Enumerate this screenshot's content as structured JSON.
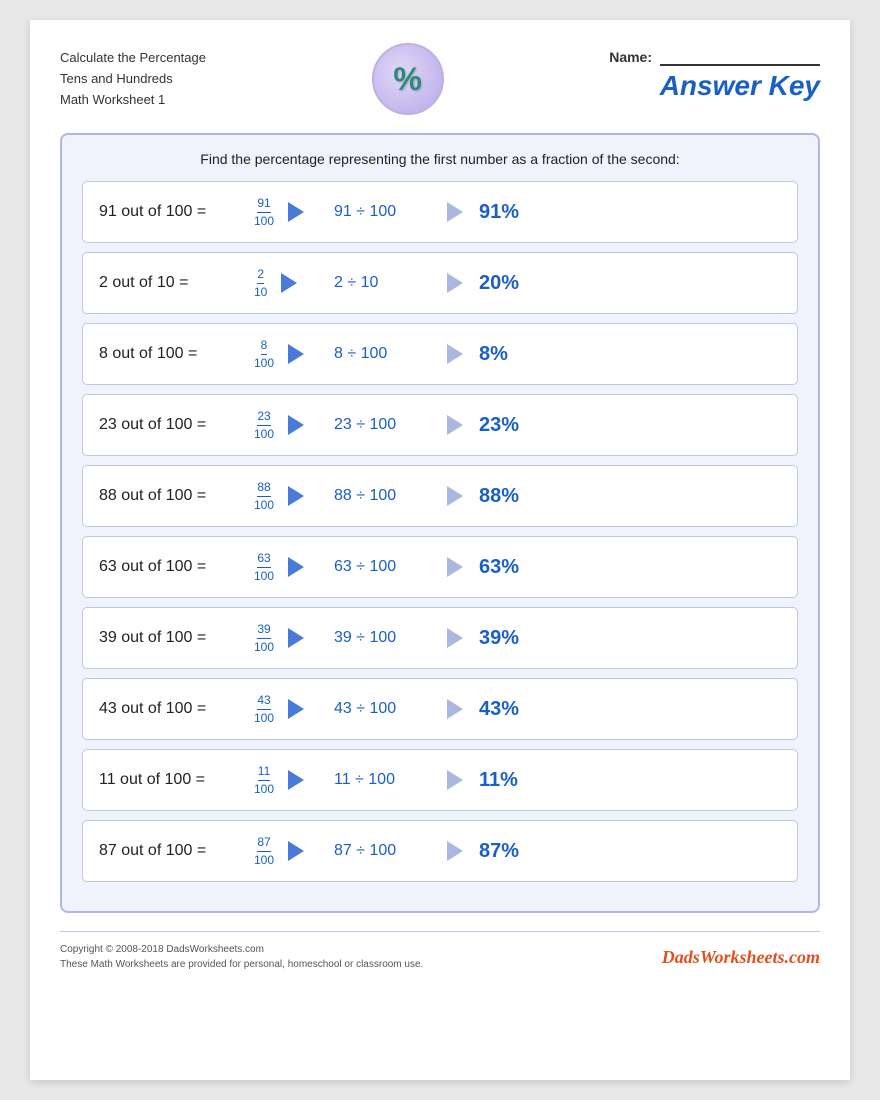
{
  "header": {
    "title_line1": "Calculate the Percentage",
    "title_line2": "Tens and Hundreds",
    "title_line3": "Math Worksheet 1",
    "name_label": "Name:",
    "answer_key": "Answer Key"
  },
  "instruction": "Find the percentage representing the first number as a fraction of the second:",
  "problems": [
    {
      "text": "91 out of 100 =",
      "num": "91",
      "den": "100",
      "division": "91 ÷ 100",
      "result": "91%"
    },
    {
      "text": "2 out of 10 =",
      "num": "2",
      "den": "10",
      "division": "2 ÷ 10",
      "result": "20%"
    },
    {
      "text": "8 out of 100 =",
      "num": "8",
      "den": "100",
      "division": "8 ÷ 100",
      "result": "8%"
    },
    {
      "text": "23 out of 100 =",
      "num": "23",
      "den": "100",
      "division": "23 ÷ 100",
      "result": "23%"
    },
    {
      "text": "88 out of 100 =",
      "num": "88",
      "den": "100",
      "division": "88 ÷ 100",
      "result": "88%"
    },
    {
      "text": "63 out of 100 =",
      "num": "63",
      "den": "100",
      "division": "63 ÷ 100",
      "result": "63%"
    },
    {
      "text": "39 out of 100 =",
      "num": "39",
      "den": "100",
      "division": "39 ÷ 100",
      "result": "39%"
    },
    {
      "text": "43 out of 100 =",
      "num": "43",
      "den": "100",
      "division": "43 ÷ 100",
      "result": "43%"
    },
    {
      "text": "11 out of 100 =",
      "num": "11",
      "den": "100",
      "division": "11 ÷ 100",
      "result": "11%"
    },
    {
      "text": "87 out of 100 =",
      "num": "87",
      "den": "100",
      "division": "87 ÷ 100",
      "result": "87%"
    }
  ],
  "footer": {
    "copyright": "Copyright © 2008-2018 DadsWorksheets.com",
    "note": "These Math Worksheets are provided for personal, homeschool or classroom use.",
    "brand": "DadsWorksheets.com"
  }
}
